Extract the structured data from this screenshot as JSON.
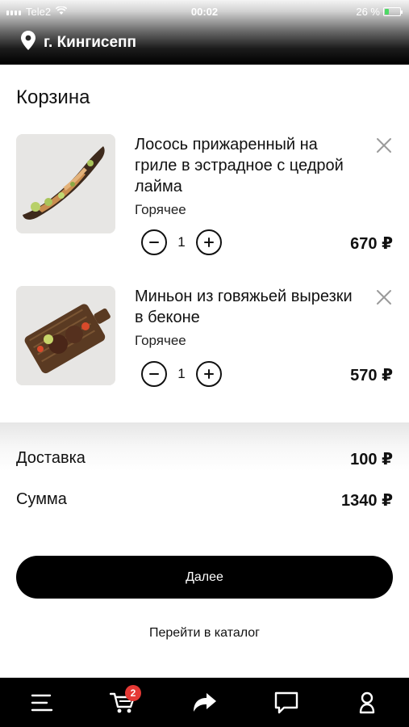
{
  "status_bar": {
    "carrier": "Tele2",
    "time": "00:02",
    "battery": "26 %",
    "battery_level": 0.26,
    "icons": [
      "signal-icon",
      "wifi-icon",
      "battery-icon"
    ]
  },
  "location": {
    "icon": "location-pin-icon",
    "city": "г. Кингисепп"
  },
  "cart": {
    "title": "Корзина",
    "items": [
      {
        "name": "Лосось прижаренный на гриле в эстрадное с цедрой лайма",
        "category": "Горячее",
        "quantity": "1",
        "price": "670 ₽",
        "remove_icon": "close-icon",
        "decrease_icon": "minus-icon",
        "increase_icon": "plus-icon"
      },
      {
        "name": "Миньон из говяжьей вырезки в беконе",
        "category": "Горячее",
        "quantity": "1",
        "price": "570 ₽",
        "remove_icon": "close-icon",
        "decrease_icon": "minus-icon",
        "increase_icon": "plus-icon"
      }
    ]
  },
  "summary": {
    "delivery_label": "Доставка",
    "delivery_value": "100 ₽",
    "total_label": "Сумма",
    "total_value": "1340 ₽"
  },
  "actions": {
    "next_label": "Далее",
    "catalog_link": "Перейти в каталог"
  },
  "bottom_nav": {
    "items": [
      "menu-icon",
      "cart-icon",
      "share-icon",
      "chat-icon",
      "profile-icon"
    ],
    "cart_badge": "2"
  },
  "colors": {
    "primary": "#000000",
    "badge": "#e53935",
    "battery": "#4cd964"
  }
}
